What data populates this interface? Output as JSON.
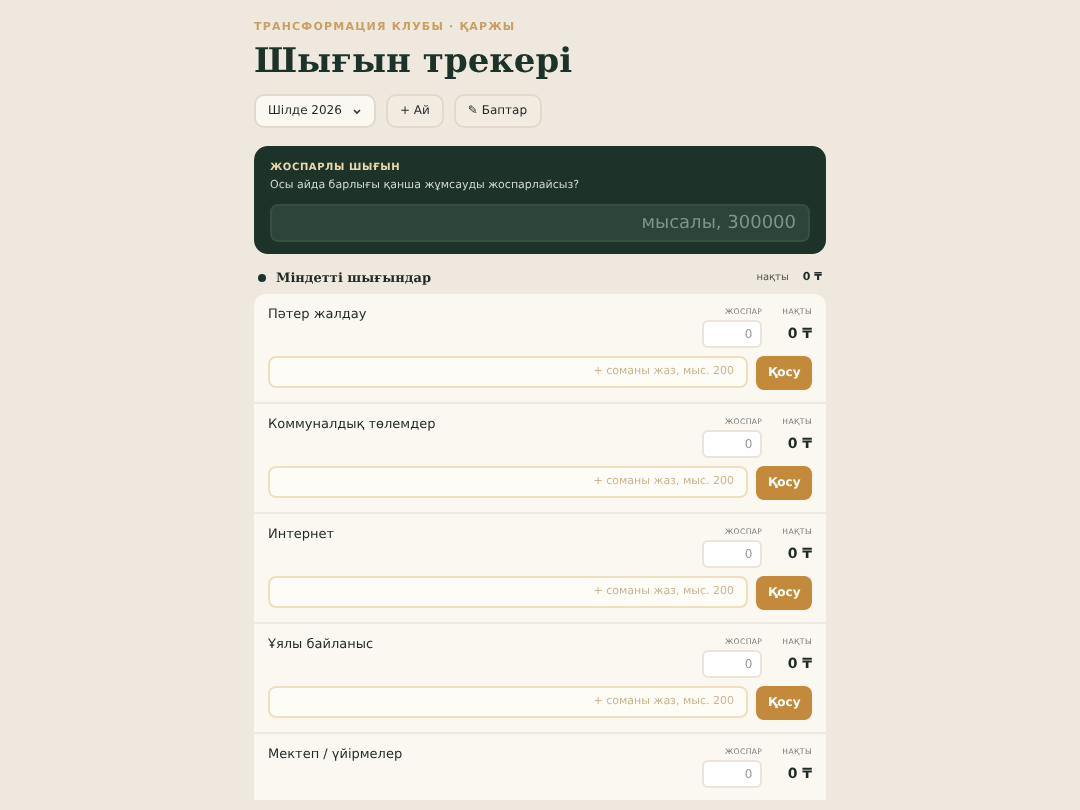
{
  "eyebrow": "ТРАНСФОРМАЦИЯ КЛУБЫ · ҚАРЖЫ",
  "title": "Шығын трекері",
  "toolbar": [
    {
      "kind": "select",
      "label": "Шілде 2026"
    },
    {
      "kind": "button",
      "label": "+ Ай"
    },
    {
      "kind": "button",
      "label": "✎ Баптар"
    }
  ],
  "plan_card": {
    "heading": "ЖОСПАРЛЫ ШЫҒЫН",
    "question": "Осы айда барлығы қанша жұмсауды жоспарлайсыз?",
    "placeholder": "мысалы, 300000"
  },
  "section": {
    "title": "Міндетті шығындар",
    "actual_label": "нақты",
    "actual_value": "0 ₸"
  },
  "rows": [
    {
      "name": "Пәтер жалдау",
      "plan_label": "ЖОСПАР",
      "plan_placeholder": "0",
      "actual_label": "НАҚТЫ",
      "actual": "0 ₸",
      "entry": {
        "placeholder": "+ соманы жаз, мыс. 200",
        "button": "Қосу"
      }
    },
    {
      "name": "Коммуналдық төлемдер",
      "plan_label": "ЖОСПАР",
      "plan_placeholder": "0",
      "actual_label": "НАҚТЫ",
      "actual": "0 ₸",
      "entry": {
        "placeholder": "+ соманы жаз, мыс. 200",
        "button": "Қосу"
      }
    },
    {
      "name": "Интернет",
      "plan_label": "ЖОСПАР",
      "plan_placeholder": "0",
      "actual_label": "НАҚТЫ",
      "actual": "0 ₸",
      "entry": {
        "placeholder": "+ соманы жаз, мыс. 200",
        "button": "Қосу"
      }
    },
    {
      "name": "Ұялы байланыс",
      "plan_label": "ЖОСПАР",
      "plan_placeholder": "0",
      "actual_label": "НАҚТЫ",
      "actual": "0 ₸",
      "entry": {
        "placeholder": "+ соманы жаз, мыс. 200",
        "button": "Қосу"
      }
    },
    {
      "name": "Мектеп / үйірмелер",
      "plan_label": "ЖОСПАР",
      "plan_placeholder": "0",
      "actual_label": "НАҚТЫ",
      "actual": "0 ₸"
    }
  ]
}
